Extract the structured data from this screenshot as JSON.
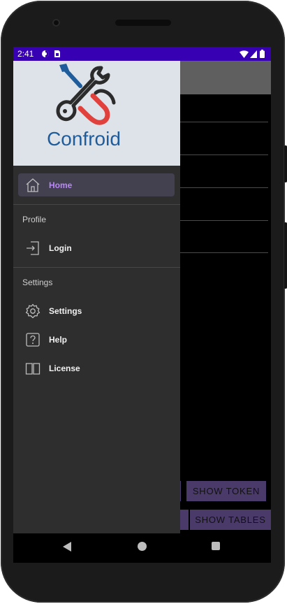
{
  "status_bar": {
    "time": "2:41",
    "left_icons": [
      "circle-status-icon",
      "sim-card-icon"
    ],
    "right_icons": [
      "wifi-icon",
      "signal-icon",
      "battery-icon"
    ],
    "color": "#3700b3"
  },
  "drawer": {
    "logo_text": "Confroid",
    "home": {
      "label": "Home",
      "icon": "home-icon",
      "active": true
    },
    "sections": [
      {
        "title": "Profile",
        "items": [
          {
            "label": "Login",
            "icon": "login-icon"
          }
        ]
      },
      {
        "title": "Settings",
        "items": [
          {
            "label": "Settings",
            "icon": "gear-icon"
          },
          {
            "label": "Help",
            "icon": "help-icon"
          },
          {
            "label": "License",
            "icon": "book-icon"
          }
        ]
      }
    ],
    "accent": "#bb86fc"
  },
  "content": {
    "buttons": {
      "show_token": "SHOW TOKEN",
      "show_tables": "SHOW TABLES"
    }
  },
  "navigation": {
    "icons": [
      "back-icon",
      "home-circle-icon",
      "recents-icon"
    ]
  }
}
